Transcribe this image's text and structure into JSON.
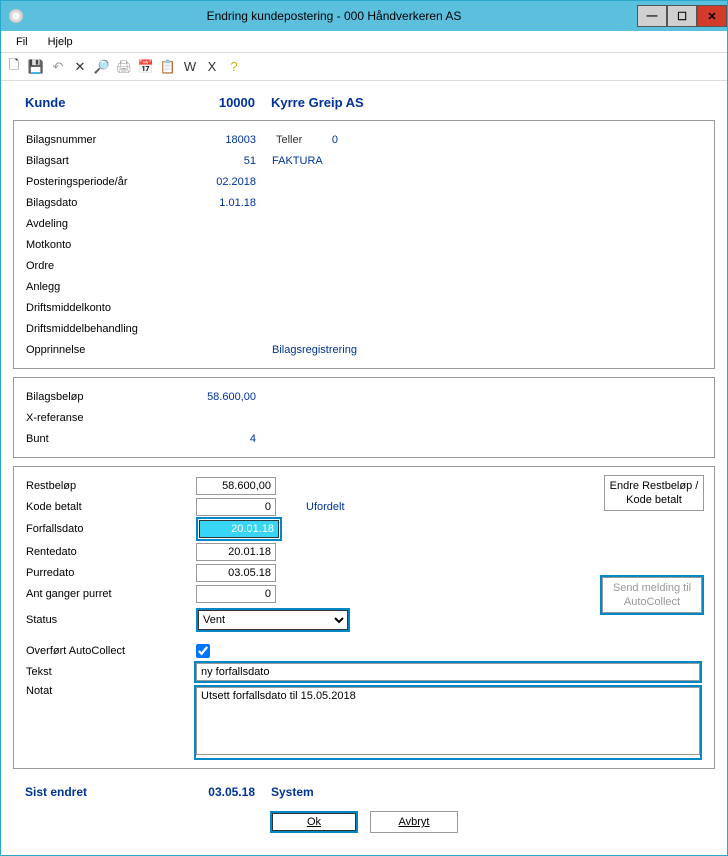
{
  "window": {
    "title": "Endring kundepostering - 000 Håndverkeren AS",
    "menu": {
      "fil": "Fil",
      "hjelp": "Hjelp"
    }
  },
  "header": {
    "kunde_label": "Kunde",
    "kunde_nr": "10000",
    "kunde_navn": "Kyrre Greip AS"
  },
  "panel1": {
    "bilagsnummer_label": "Bilagsnummer",
    "bilagsnummer_value": "18003",
    "teller_label": "Teller",
    "teller_value": "0",
    "bilagsart_label": "Bilagsart",
    "bilagsart_value": "51",
    "bilagsart_text": "FAKTURA",
    "periode_label": "Posteringsperiode/år",
    "periode_value": "02.2018",
    "bilagsdato_label": "Bilagsdato",
    "bilagsdato_value": "1.01.18",
    "avdeling_label": "Avdeling",
    "motkonto_label": "Motkonto",
    "ordre_label": "Ordre",
    "anlegg_label": "Anlegg",
    "driftsmiddelkonto_label": "Driftsmiddelkonto",
    "driftsmiddelbehandling_label": "Driftsmiddelbehandling",
    "opprinnelse_label": "Opprinnelse",
    "opprinnelse_value": "Bilagsregistrering"
  },
  "panel2": {
    "bilagsbelop_label": "Bilagsbeløp",
    "bilagsbelop_value": "58.600,00",
    "xref_label": "X-referanse",
    "bunt_label": "Bunt",
    "bunt_value": "4"
  },
  "panel3": {
    "restbelop_label": "Restbeløp",
    "restbelop_value": "58.600,00",
    "kodebetalt_label": "Kode betalt",
    "kodebetalt_value": "0",
    "ufordelt_text": "Ufordelt",
    "forfallsdato_label": "Forfallsdato",
    "forfallsdato_value": "20.01.18",
    "rentedato_label": "Rentedato",
    "rentedato_value": "20.01.18",
    "purredato_label": "Purredato",
    "purredato_value": "03.05.18",
    "antganger_label": "Ant ganger purret",
    "antganger_value": "0",
    "status_label": "Status",
    "status_value": "Vent",
    "overfort_label": "Overført AutoCollect",
    "overfort_checked": true,
    "tekst_label": "Tekst",
    "tekst_value": "ny forfallsdato",
    "notat_label": "Notat",
    "notat_value": "Utsett forfallsdato til 15.05.2018",
    "btn_endre": "Endre Restbeløp / Kode betalt",
    "btn_send": "Send melding til AutoCollect"
  },
  "footer": {
    "sist_endret_label": "Sist endret",
    "sist_endret_date": "03.05.18",
    "sist_endret_user": "System",
    "btn_ok": "Ok",
    "btn_avbryt": "Avbryt"
  }
}
